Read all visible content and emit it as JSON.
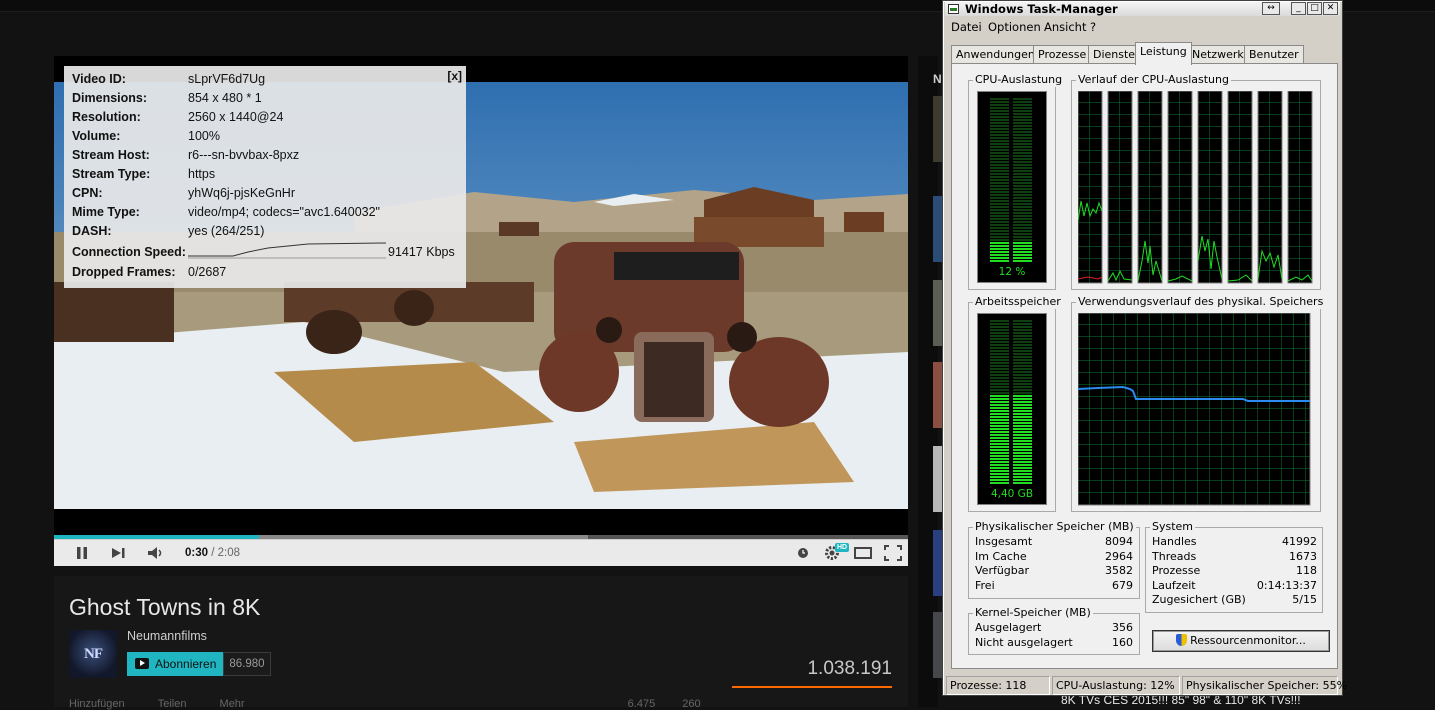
{
  "video_stats": {
    "close_label": "[x]",
    "rows": [
      {
        "key": "Video ID:",
        "value": "sLprVF6d7Ug"
      },
      {
        "key": "Dimensions:",
        "value": "854 x 480 * 1"
      },
      {
        "key": "Resolution:",
        "value": "2560 x 1440@24"
      },
      {
        "key": "Volume:",
        "value": "100%"
      },
      {
        "key": "Stream Host:",
        "value": "r6---sn-bvvbax-8pxz"
      },
      {
        "key": "Stream Type:",
        "value": "https"
      },
      {
        "key": "CPN:",
        "value": "yhWq6j-pjsKeGnHr"
      },
      {
        "key": "Mime Type:",
        "value": "video/mp4; codecs=\"avc1.640032\""
      },
      {
        "key": "DASH:",
        "value": "yes (264/251)"
      }
    ],
    "connection_speed_label": "Connection Speed:",
    "connection_speed_value": "91417 Kbps",
    "dropped_frames_label": "Dropped Frames:",
    "dropped_frames_value": "0/2687"
  },
  "player": {
    "current_time": "0:30",
    "duration_sep": " / ",
    "duration": "2:08",
    "played_fraction": 0.24,
    "loaded_fraction": 0.625,
    "hd_badge": "HD",
    "accent_color": "#1fb6c1"
  },
  "watch": {
    "title": "Ghost Towns in 8K",
    "channel_name": "Neumannfilms",
    "avatar_text": "NF",
    "subscribe_label": "Abonnieren",
    "subscriber_count": "86.980",
    "view_count": "1.038.191",
    "actions": [
      "Hinzufügen",
      "Teilen",
      "Mehr"
    ],
    "likes": "6.475",
    "dislikes": "260"
  },
  "sidebar": {
    "label": "N",
    "bottom_title": "8K TVs CES 2015!!! 85\" 98\" & 110\" 8K TVs!!!"
  },
  "taskmgr": {
    "window_title": "Windows Task-Manager",
    "menu": [
      "Datei",
      "Optionen",
      "Ansicht",
      "?"
    ],
    "tabs": [
      "Anwendungen",
      "Prozesse",
      "Dienste",
      "Leistung",
      "Netzwerk",
      "Benutzer"
    ],
    "active_tab": "Leistung",
    "cpu_usage_title": "CPU-Auslastung",
    "cpu_usage_value": "12 %",
    "cpu_usage_fraction": 0.12,
    "cpu_history_title": "Verlauf der CPU-Auslastung",
    "memory_title": "Arbeitsspeicher",
    "memory_value": "4,40 GB",
    "memory_fraction": 0.55,
    "memory_history_title": "Verwendungsverlauf des physikal. Speichers",
    "physical_memory": {
      "title": "Physikalischer Speicher (MB)",
      "rows": [
        {
          "label": "Insgesamt",
          "value": "8094"
        },
        {
          "label": "Im Cache",
          "value": "2964"
        },
        {
          "label": "Verfügbar",
          "value": "3582"
        },
        {
          "label": "Frei",
          "value": "679"
        }
      ]
    },
    "kernel_memory": {
      "title": "Kernel-Speicher (MB)",
      "rows": [
        {
          "label": "Ausgelagert",
          "value": "356"
        },
        {
          "label": "Nicht ausgelagert",
          "value": "160"
        }
      ]
    },
    "system": {
      "title": "System",
      "rows": [
        {
          "label": "Handles",
          "value": "41992"
        },
        {
          "label": "Threads",
          "value": "1673"
        },
        {
          "label": "Prozesse",
          "value": "118"
        },
        {
          "label": "Laufzeit",
          "value": "0:14:13:37"
        },
        {
          "label": "Zugesichert (GB)",
          "value": "5/15"
        }
      ]
    },
    "resource_monitor_label": "Ressourcenmonitor...",
    "status": {
      "processes": "Prozesse: 118",
      "cpu": "CPU-Auslastung: 12%",
      "memory": "Physikalischer Speicher: 55%"
    }
  }
}
